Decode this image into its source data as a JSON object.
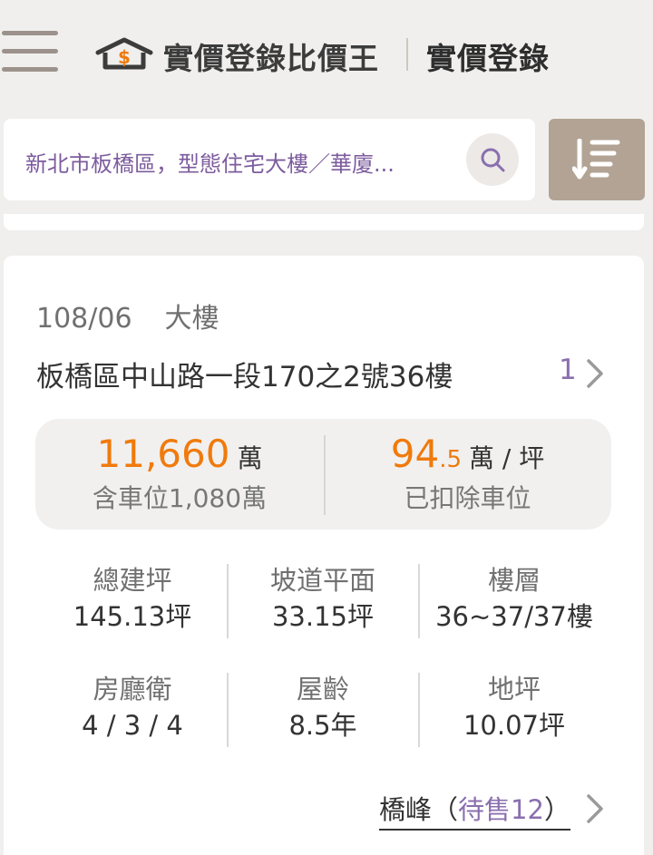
{
  "header": {
    "brand": "實價登錄比價王",
    "section_title": "實價登錄"
  },
  "search": {
    "query": "新北市板橋區，型態住宅大樓／華廈..."
  },
  "listing": {
    "date": "108/06",
    "type": "大樓",
    "address": "板橋區中山路一段170之2號36樓",
    "count": "1",
    "price": {
      "total_value": "11,660",
      "total_unit": "萬",
      "total_sub": "含車位1,080萬",
      "unit_int": "94",
      "unit_dec": ".5",
      "unit_unit": "萬 / 坪",
      "unit_sub": "已扣除車位"
    },
    "stats": [
      {
        "label": "總建坪",
        "value": "145.13坪"
      },
      {
        "label": "坡道平面",
        "value": "33.15坪"
      },
      {
        "label": "樓層",
        "value": "36~37/37樓"
      },
      {
        "label": "房廳衛",
        "value": "4 / 3 / 4"
      },
      {
        "label": "屋齡",
        "value": "8.5年"
      },
      {
        "label": "地坪",
        "value": "10.07坪"
      }
    ],
    "community": {
      "name": "橋峰",
      "open": "（",
      "pending": "待售12",
      "close": "）"
    }
  },
  "colors": {
    "accent_orange": "#f07a0c",
    "accent_purple": "#8a6fae",
    "sort_button": "#b2a394"
  },
  "icons": [
    "menu-icon",
    "house-dollar-logo-icon",
    "search-icon",
    "sort-icon",
    "chevron-right-icon"
  ]
}
